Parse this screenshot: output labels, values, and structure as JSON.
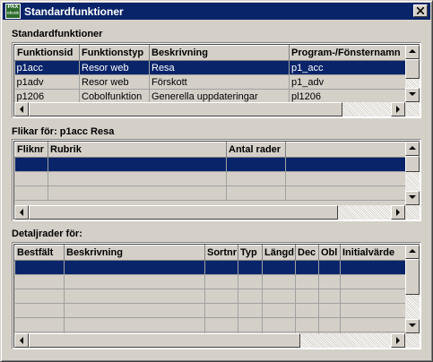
{
  "window": {
    "title": "Standardfunktioner",
    "icon_text_top": "PAX",
    "icon_text_bottom": "ekvok"
  },
  "colors": {
    "titlebar": "#0a246a",
    "selection": "#0a246a",
    "face": "#d4d0c8"
  },
  "standard": {
    "label": "Standardfunktioner",
    "columns": [
      "Funktionsid",
      "Funktionstyp",
      "Beskrivning",
      "Program-/Fönsternamn"
    ],
    "rows": [
      [
        "p1acc",
        "Resor web",
        "Resa",
        "p1_acc"
      ],
      [
        "p1adv",
        "Resor web",
        "Förskott",
        "p1_adv"
      ],
      [
        "p1206",
        "Cobolfunktion",
        "Generella uppdateringar",
        "pl1206"
      ]
    ]
  },
  "flikar": {
    "label": "Flikar för: p1acc Resa",
    "columns": [
      "Fliknr",
      "Rubrik",
      "Antal rader",
      ""
    ]
  },
  "detalj": {
    "label": "Detaljrader för:",
    "columns": [
      "Bestfält",
      "Beskrivning",
      "Sortnr",
      "Typ",
      "Längd",
      "Dec",
      "Obl",
      "Initialvärde"
    ]
  }
}
